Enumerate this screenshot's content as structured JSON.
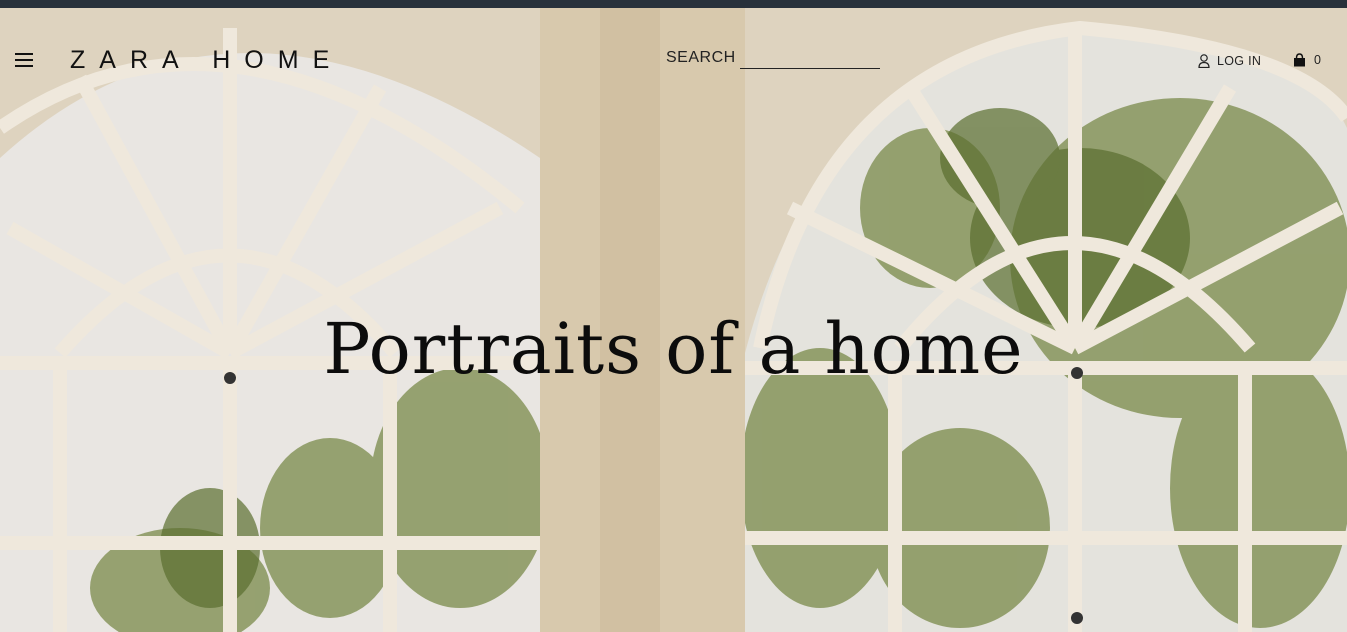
{
  "brand": {
    "logo_text": "ZARA HOME"
  },
  "header": {
    "menu_icon": "hamburger-icon",
    "search_label": "SEARCH",
    "login_label": "LOG IN",
    "user_icon": "user-icon",
    "cart_icon": "shopping-bag-icon",
    "cart_count": "0"
  },
  "hero": {
    "title": "Portraits of a home"
  },
  "colors": {
    "topbar": "#28313b",
    "text": "#111111"
  }
}
